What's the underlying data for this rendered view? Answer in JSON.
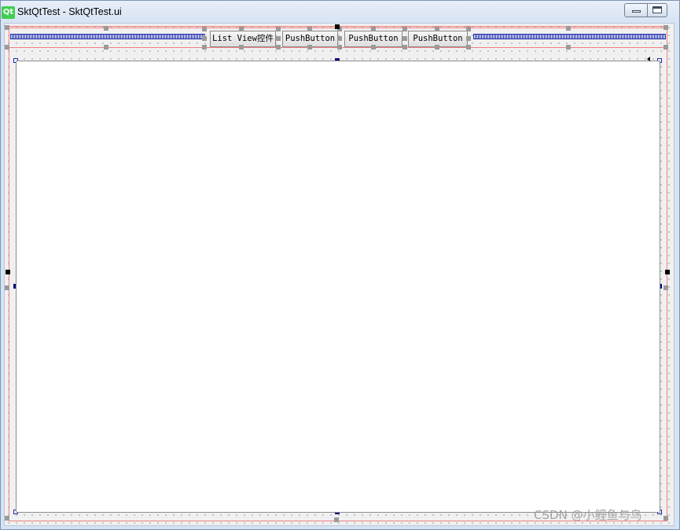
{
  "window": {
    "title": "SktQtTest - SktQtTest.ui",
    "logo_text": "Qt",
    "logo_color": "#41cd52",
    "minimize_icon": "minimize-icon",
    "maximize_icon": "maximize-icon"
  },
  "toolbar_row": {
    "buttons": [
      {
        "label": "List View控件"
      },
      {
        "label": "PushButton"
      },
      {
        "label": "PushButton"
      },
      {
        "label": "PushButton"
      }
    ]
  },
  "colors": {
    "layout_border": "#f08080",
    "spacer": "#1a2aa8",
    "selection_handle": "#0a0a78"
  },
  "watermark": "CSDN @小鲤鱼与鸟"
}
